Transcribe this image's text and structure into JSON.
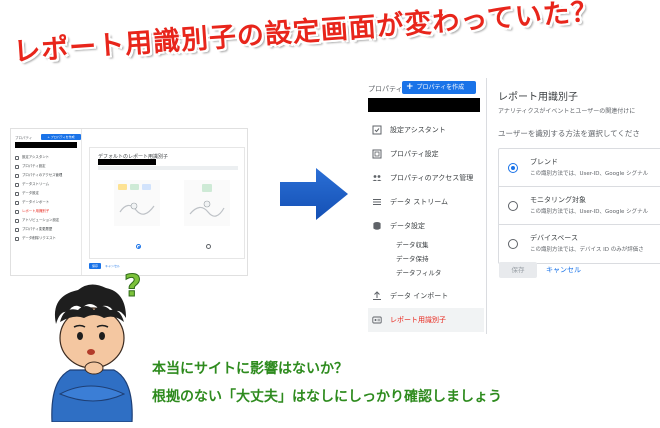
{
  "headline": "レポート用識別子の設定画面が変わっていた？",
  "old_screen": {
    "property_label": "プロパティ",
    "create_button": "+ プロパティを作成",
    "nav_items": [
      "設定アシスタント",
      "プロパティ設定",
      "プロパティのアクセス管理",
      "データストリーム",
      "データ設定",
      "データインポート",
      "レポート用識別子",
      "アトリビューション設定",
      "プロパティ変更履歴",
      "データ削除リクエスト"
    ],
    "panel_title": "デフォルトのレポート用識別子",
    "save_label": "保存",
    "cancel_label": "キャンセル"
  },
  "new_screen": {
    "property_label": "プロパティ",
    "create_button": "プロパティを作成",
    "nav": {
      "setup_assistant": "設定アシスタント",
      "property_settings": "プロパティ設定",
      "access_management": "プロパティのアクセス管理",
      "data_streams": "データ ストリーム",
      "data_settings": "データ設定",
      "data_collection": "データ収集",
      "data_retention": "データ保持",
      "data_filters": "データフィルタ",
      "data_import": "データ インポート",
      "reporting_identity": "レポート用識別子"
    },
    "panel_title": "レポート用識別子",
    "panel_description": "アナリティクスがイベントとユーザーの関連付けに",
    "panel_question": "ユーザーを識別する方法を選択してくださ",
    "options": [
      {
        "name": "ブレンド",
        "description": "この識別方法では、User-ID、Google シグナル",
        "selected": true
      },
      {
        "name": "モニタリング対象",
        "description": "この識別方法では、User-ID、Google シグナル",
        "selected": false
      },
      {
        "name": "デバイスベース",
        "description": "この識別方法では、デバイス ID のみが評価さ",
        "selected": false
      }
    ],
    "save_label": "保存",
    "cancel_label": "キャンセル"
  },
  "bottom_text": {
    "line1": "本当にサイトに影響はないか？",
    "line2": "根拠のない「大丈夫」はなしにしっかり確認しましょう"
  },
  "colors": {
    "headline": "#e8251b",
    "accent": "#1a73e8",
    "active_nav": "#e8251b",
    "bottom_text": "#2e8b1e"
  }
}
